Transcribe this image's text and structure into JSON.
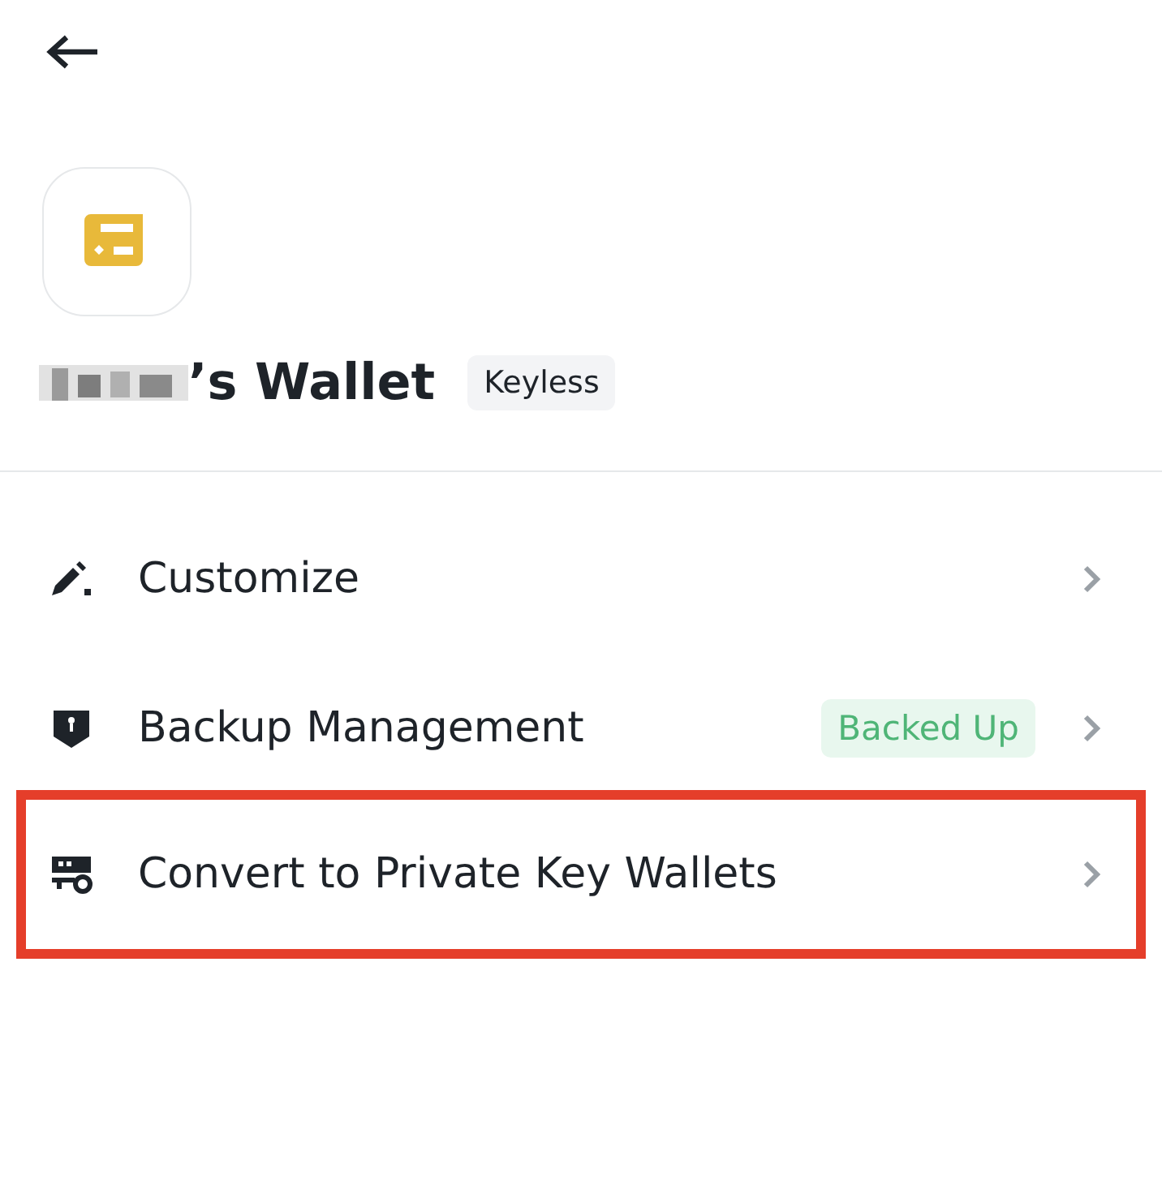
{
  "header": {
    "title_suffix": "’s Wallet",
    "name_redacted": true,
    "badge": "Keyless"
  },
  "menu": [
    {
      "kind": "edit",
      "label": "Customize",
      "highlighted": false
    },
    {
      "kind": "shield",
      "label": "Backup Management",
      "badge": "Backed Up",
      "highlighted": false
    },
    {
      "kind": "convert",
      "label": "Convert to Private Key Wallets",
      "highlighted": true
    }
  ]
}
